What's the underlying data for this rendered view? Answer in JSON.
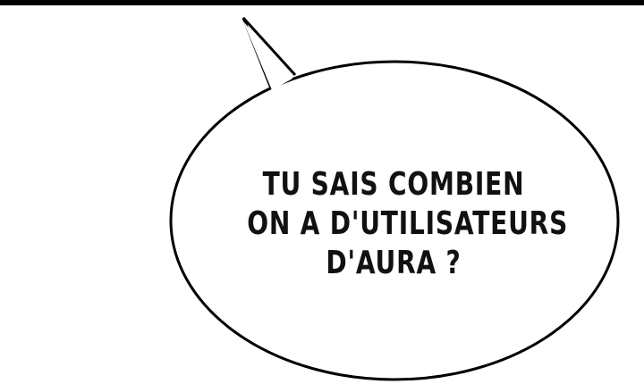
{
  "panel": {
    "speech_bubble": {
      "lines": [
        "TU SAIS COMBIEN",
        "ON A D'UTILISATEURS",
        "D'AURA ?"
      ]
    }
  },
  "colors": {
    "background": "#ffffff",
    "ink": "#111111",
    "top_bar": "#000000"
  }
}
